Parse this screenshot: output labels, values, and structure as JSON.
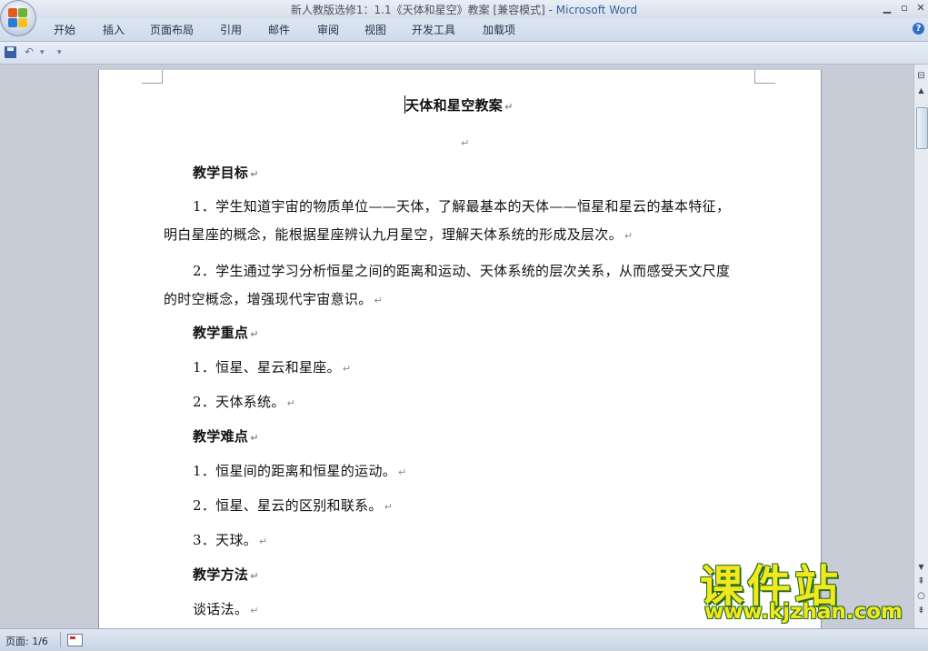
{
  "window": {
    "title_doc": "新人教版选修1：1.1《天体和星空》教案 [兼容模式]",
    "title_sep": " - ",
    "title_app": "Microsoft Word",
    "controls": [
      "▁",
      "▫",
      "✕"
    ]
  },
  "ribbon": {
    "tabs": [
      "开始",
      "插入",
      "页面布局",
      "引用",
      "邮件",
      "审阅",
      "视图",
      "开发工具",
      "加载项"
    ],
    "help": "?"
  },
  "qat": {
    "undo": "↶",
    "undo_dropdown": "▾",
    "customize": "▾"
  },
  "document": {
    "title": "天体和星空教案",
    "empty_mark": "↵",
    "sections": [
      {
        "heading": "教学目标",
        "items": [
          "1．学生知道宇宙的物质单位——天体，了解最基本的天体——恒星和星云的基本特征，",
          "明白星座的概念，能根据星座辨认九月星空，理解天体系统的形成及层次。",
          "2．学生通过学习分析恒星之间的距离和运动、天体系统的层次关系，从而感受天文尺度",
          "的时空概念，增强现代宇宙意识。"
        ]
      },
      {
        "heading": "教学重点",
        "items": [
          "1．恒星、星云和星座。",
          "2．天体系统。"
        ]
      },
      {
        "heading": "教学难点",
        "items": [
          "1．恒星间的距离和恒星的运动。",
          "2．恒星、星云的区别和联系。",
          "3．天球。"
        ]
      },
      {
        "heading": "教学方法",
        "items": [
          "谈话法。"
        ]
      }
    ],
    "para_mark": "↵"
  },
  "scrollbar": {
    "up": "▲",
    "down": "▼",
    "prev_page": "⇞",
    "browse": "○",
    "next_page": "⇟",
    "ruler_toggle": "⊟"
  },
  "status": {
    "page": "页面: 1/6"
  },
  "watermark": {
    "title": "课件站",
    "url": "www.kjzhan.com"
  }
}
